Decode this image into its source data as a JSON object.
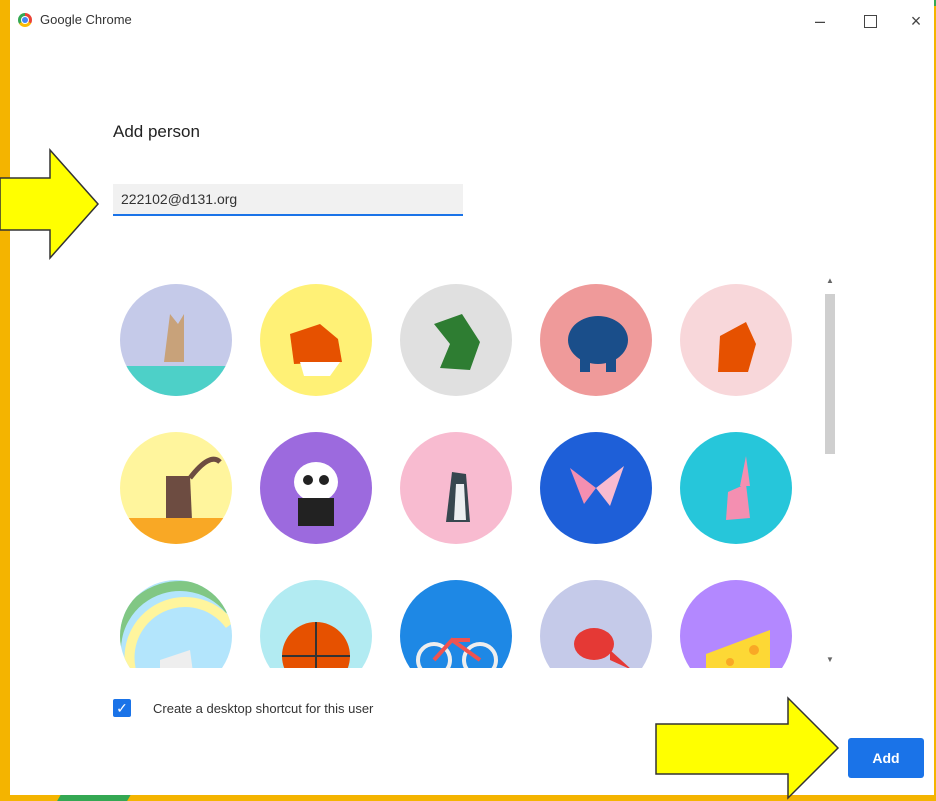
{
  "window": {
    "title": "Google Chrome",
    "controls": {
      "minimize": "–",
      "close": "×"
    }
  },
  "dialog": {
    "heading": "Add person",
    "email_value": "222102@d131.org",
    "avatars": [
      {
        "name": "cat",
        "bg": "#c5cae9"
      },
      {
        "name": "corgi",
        "bg": "#fff176"
      },
      {
        "name": "dragon",
        "bg": "#e0e0e0"
      },
      {
        "name": "elephant",
        "bg": "#ef9a9a"
      },
      {
        "name": "fox",
        "bg": "#f8d7da"
      },
      {
        "name": "monkey",
        "bg": "#fff59d"
      },
      {
        "name": "panda",
        "bg": "#9c6ade"
      },
      {
        "name": "penguin",
        "bg": "#f8bbd0"
      },
      {
        "name": "butterfly",
        "bg": "#1e5fd8"
      },
      {
        "name": "rabbit",
        "bg": "#26c6da"
      },
      {
        "name": "unicorn",
        "bg": "#b3e5fc"
      },
      {
        "name": "basketball",
        "bg": "#b2ebf2"
      },
      {
        "name": "bike",
        "bg": "#1e88e5"
      },
      {
        "name": "bird",
        "bg": "#c5cae9"
      },
      {
        "name": "cheese",
        "bg": "#b388ff"
      }
    ],
    "shortcut_checked": true,
    "shortcut_label": "Create a desktop shortcut for this user",
    "add_label": "Add"
  },
  "colors": {
    "accent": "#1a73e8",
    "frame": "#f4b400",
    "arrow": "#ffff00"
  }
}
